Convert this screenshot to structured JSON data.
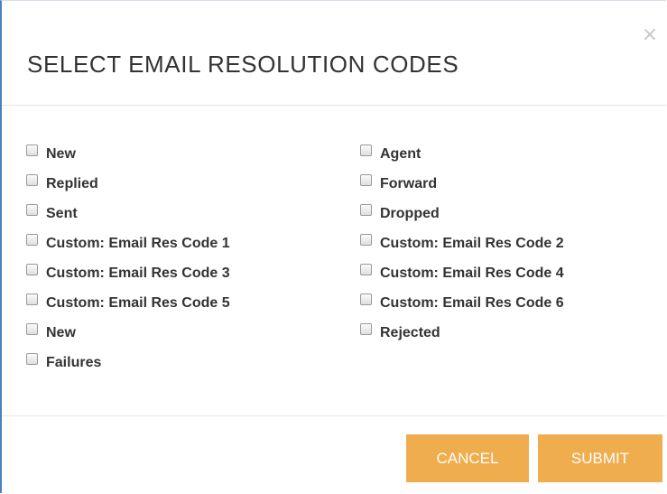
{
  "dialog": {
    "title": "SELECT EMAIL RESOLUTION CODES",
    "close_symbol": "×",
    "close_icon": "close-icon"
  },
  "options": {
    "left": [
      {
        "label": "New",
        "checked": false
      },
      {
        "label": "Replied",
        "checked": false
      },
      {
        "label": "Sent",
        "checked": false
      },
      {
        "label": "Custom: Email Res Code 1",
        "checked": false
      },
      {
        "label": "Custom: Email Res Code 3",
        "checked": false
      },
      {
        "label": "Custom: Email Res Code 5",
        "checked": false
      },
      {
        "label": "New",
        "checked": false
      },
      {
        "label": "Failures",
        "checked": false
      }
    ],
    "right": [
      {
        "label": "Agent",
        "checked": false
      },
      {
        "label": "Forward",
        "checked": false
      },
      {
        "label": "Dropped",
        "checked": false
      },
      {
        "label": "Custom: Email Res Code 2",
        "checked": false
      },
      {
        "label": "Custom: Email Res Code 4",
        "checked": false
      },
      {
        "label": "Custom: Email Res Code 6",
        "checked": false
      },
      {
        "label": "Rejected",
        "checked": false
      }
    ]
  },
  "footer": {
    "cancel_label": "CANCEL",
    "submit_label": "SUBMIT"
  },
  "colors": {
    "button_accent": "#f0ad4e",
    "left_border_accent": "#4a7fc1",
    "title_text": "#333333"
  }
}
